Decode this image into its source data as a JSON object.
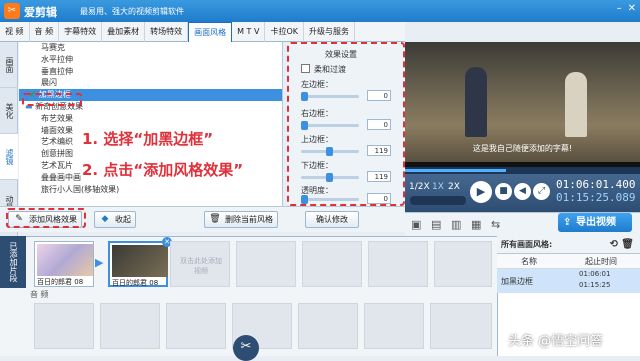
{
  "app": {
    "name": "爱剪辑",
    "slogan": "最易用、强大的视频剪辑软件",
    "logo_glyph": "✂"
  },
  "tabs": [
    {
      "label": "视 频"
    },
    {
      "label": "音 频"
    },
    {
      "label": "字幕特效"
    },
    {
      "label": "叠加素材"
    },
    {
      "label": "转场特效"
    },
    {
      "label": "画面风格",
      "active": true
    },
    {
      "label": "M T V"
    },
    {
      "label": "卡拉OK"
    },
    {
      "label": "升级与服务"
    }
  ],
  "side_tabs": [
    {
      "label": "画面"
    },
    {
      "label": "美化"
    },
    {
      "label": "滤镜",
      "active": true
    },
    {
      "label": "动景"
    }
  ],
  "effects": [
    {
      "label": "马赛克"
    },
    {
      "label": "水平拉伸"
    },
    {
      "label": "垂直拉伸"
    },
    {
      "label": "晨闪"
    },
    {
      "label": "加黑边框",
      "selected": true
    },
    {
      "label": "新奇创意效果",
      "category": true
    },
    {
      "label": "布艺效果"
    },
    {
      "label": "墙面效果"
    },
    {
      "label": "艺术编织"
    },
    {
      "label": "创意拼图"
    },
    {
      "label": "艺术瓦片"
    },
    {
      "label": "叠叠画中画"
    },
    {
      "label": "旅行小人国(移轴效果)"
    }
  ],
  "annotations": {
    "step1": "1. 选择“加黑边框”",
    "step2": "2. 点击“添加风格效果”"
  },
  "settings": {
    "title": "效果设置",
    "soft_filter_label": "柔和过渡",
    "sliders": [
      {
        "label": "左边框：",
        "value": 0
      },
      {
        "label": "右边框：",
        "value": 0
      },
      {
        "label": "上边框：",
        "value": 119
      },
      {
        "label": "下边框：",
        "value": 119
      },
      {
        "label": "透明度：",
        "value": 0
      }
    ],
    "slider_max": 240,
    "confirm_label": "确认修改"
  },
  "actions": {
    "add_label": "添加风格效果",
    "collapse_label": "收起",
    "delete_label": "删除当前风格"
  },
  "preview": {
    "subtitle": "这是我自己随便添加的字幕!"
  },
  "player": {
    "speeds": [
      "1/2X",
      "1X",
      "2X"
    ],
    "current_time": "01:06:01.400",
    "total_time": "01:15:25.089",
    "progress_fraction": 0.43
  },
  "export_label": "导出视频",
  "timeline": {
    "added_label": "已添加片段",
    "clips": [
      {
        "name": "百日的郎君",
        "index": "08"
      },
      {
        "name": "百日的郎君",
        "index": "08"
      }
    ],
    "placeholder": "双击此处添加视频",
    "audio_label": "音 频"
  },
  "styles_panel": {
    "title": "所有画面风格:",
    "col_name": "名称",
    "col_time": "起止时间",
    "rows": [
      {
        "name": "加黑边框",
        "start": "01:06:01",
        "end": "01:15:25"
      }
    ]
  },
  "watermark": "头条 @悟空问答",
  "colors": {
    "accent": "#1f7ccb",
    "highlight": "#e0303a",
    "selected_row": "#3d8fe0"
  }
}
